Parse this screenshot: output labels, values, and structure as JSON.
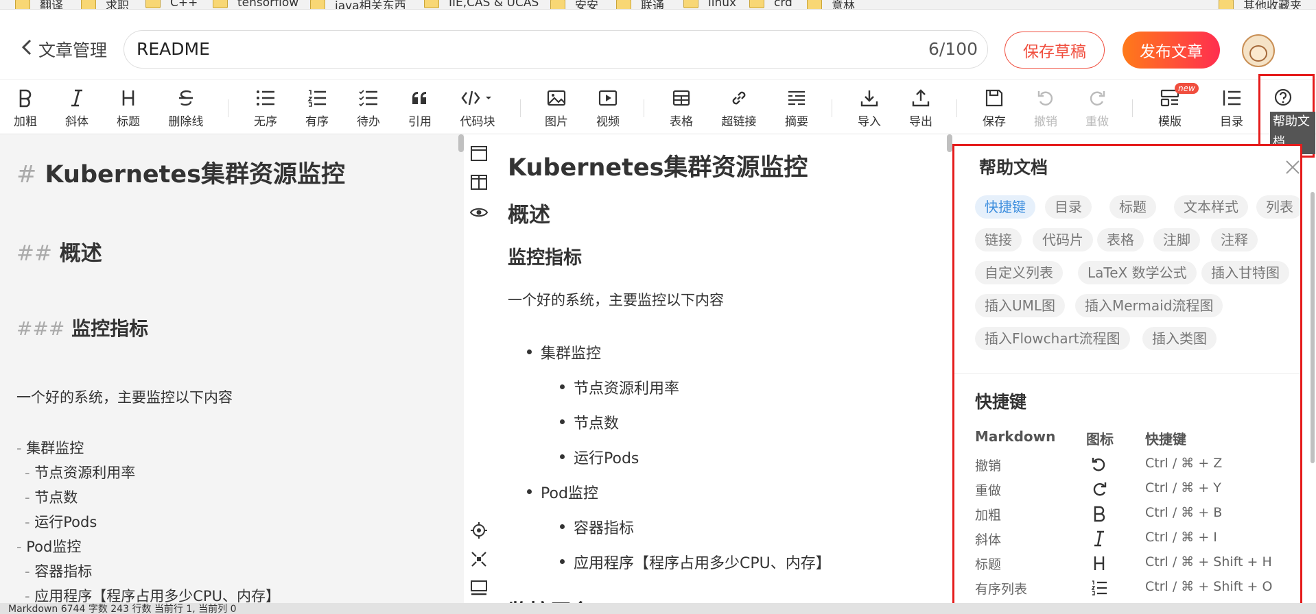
{
  "bookmarks": [
    {
      "label": "翻译"
    },
    {
      "label": "求职"
    },
    {
      "label": "C++"
    },
    {
      "label": "tensorflow"
    },
    {
      "label": "java相关东西"
    },
    {
      "label": "IIE,CAS & UCAS"
    },
    {
      "label": "安安"
    },
    {
      "label": "联通"
    },
    {
      "label": "linux"
    },
    {
      "label": "crd"
    },
    {
      "label": "意林"
    },
    {
      "label": "其他收藏夹"
    }
  ],
  "header": {
    "back_label": "文章管理",
    "title_value": "README",
    "title_count": "6/100",
    "draft_label": "保存草稿",
    "publish_label": "发布文章"
  },
  "toolbar": {
    "bold": "加粗",
    "italic": "斜体",
    "heading": "标题",
    "strike": "删除线",
    "ul": "无序",
    "ol": "有序",
    "todo": "待办",
    "quote": "引用",
    "code": "代码块",
    "image": "图片",
    "video": "视频",
    "table": "表格",
    "link": "超链接",
    "summary": "摘要",
    "import": "导入",
    "export": "导出",
    "save": "保存",
    "undo": "撤销",
    "redo": "重做",
    "template": "模版",
    "new_badge": "new",
    "toc": "目录",
    "help_tip": "帮助文档"
  },
  "editor": {
    "h1_mark": "#",
    "h1_text": "Kubernetes集群资源监控",
    "h2_mark": "##",
    "h2_text": "概述",
    "h3_mark": "###",
    "h3_text": "监控指标",
    "para": "一个好的系统，主要监控以下内容",
    "lines": [
      "集群监控",
      "节点资源利用率",
      "节点数",
      "运行Pods",
      "Pod监控",
      "容器指标",
      "应用程序【程序占用多少CPU、内存】"
    ]
  },
  "preview": {
    "h1": "Kubernetes集群资源监控",
    "h2": "概述",
    "h3": "监控指标",
    "para": "一个好的系统，主要监控以下内容",
    "items": [
      "集群监控",
      "节点资源利用率",
      "节点数",
      "运行Pods",
      "Pod监控",
      "容器指标",
      "应用程序【程序占用多少CPU、内存】"
    ],
    "partial_heading": "监控平台"
  },
  "help": {
    "title": "帮助文档",
    "tags": [
      "快捷键",
      "目录",
      "标题",
      "文本样式",
      "列表",
      "链接",
      "代码片",
      "表格",
      "注脚",
      "注释",
      "自定义列表",
      "LaTeX 数学公式",
      "插入甘特图",
      "插入UML图",
      "插入Mermaid流程图",
      "插入Flowchart流程图",
      "插入类图"
    ],
    "section": "快捷键",
    "col_md": "Markdown",
    "col_icon": "图标",
    "col_key": "快捷键",
    "rows": [
      {
        "name": "撤销",
        "icon": "undo-icon",
        "key": "Ctrl / ⌘ + Z"
      },
      {
        "name": "重做",
        "icon": "redo-icon",
        "key": "Ctrl / ⌘ + Y"
      },
      {
        "name": "加粗",
        "icon": "bold-icon",
        "key": "Ctrl / ⌘ + B"
      },
      {
        "name": "斜体",
        "icon": "italic-icon",
        "key": "Ctrl / ⌘ + I"
      },
      {
        "name": "标题",
        "icon": "heading-icon",
        "key": "Ctrl / ⌘ + Shift + H"
      },
      {
        "name": "有序列表",
        "icon": "ordered-list-icon",
        "key": "Ctrl / ⌘ + Shift + O"
      }
    ]
  },
  "status": {
    "text": "Markdown  6744 字数  243 行数  当前行 1, 当前列 0"
  },
  "colors": {
    "accent": "#f04e3e",
    "highlight_border": "#e51c1c",
    "tag_active": "#3f8fde"
  }
}
